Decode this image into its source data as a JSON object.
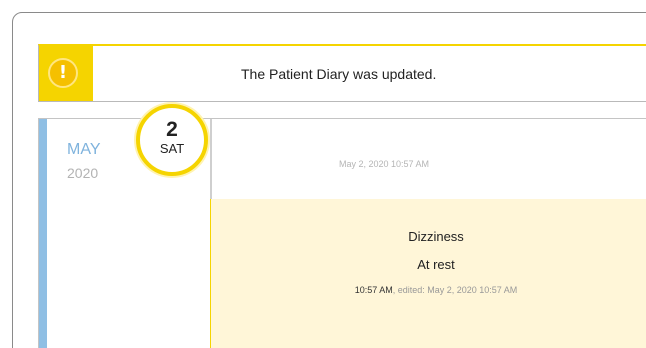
{
  "notification": {
    "icon": "warning-icon",
    "icon_glyph": "!",
    "message": "The Patient Diary was updated.",
    "accent_color": "#f5d400"
  },
  "diary": {
    "month": "MAY",
    "year": "2020",
    "accent_color": "#8fbfe4",
    "entry_timestamp": "May 2, 2020 10:57 AM",
    "day_badge": {
      "day": "2",
      "weekday": "SAT"
    },
    "entry": {
      "title": "Dizziness",
      "subtitle": "At rest",
      "time": "10:57 AM",
      "edited_label": ", edited: May 2, 2020 10:57 AM",
      "background": "#fff6d8"
    }
  }
}
